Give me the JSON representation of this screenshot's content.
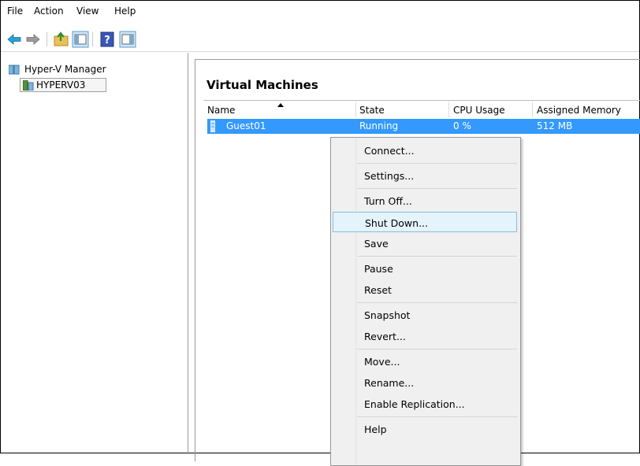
{
  "menubar": {
    "items": [
      "File",
      "Action",
      "View",
      "Help"
    ]
  },
  "toolbar": {
    "icons": [
      "back-arrow-icon",
      "forward-arrow-icon",
      "up-folder-icon",
      "show-hide-console-tree-icon",
      "help-icon",
      "show-hide-action-pane-icon"
    ]
  },
  "tree": {
    "root_label": "Hyper-V Manager",
    "server_label": "HYPERV03"
  },
  "pane": {
    "title": "Virtual Machines"
  },
  "table": {
    "headers": [
      "Name",
      "State",
      "CPU Usage",
      "Assigned Memory"
    ],
    "rows": [
      {
        "name": "Guest01",
        "state": "Running",
        "cpu": "0 %",
        "memory": "512 MB"
      }
    ]
  },
  "context_menu": {
    "items": [
      "Connect...",
      "Settings...",
      "Turn Off...",
      "Shut Down...",
      "Save",
      "Pause",
      "Reset",
      "Snapshot",
      "Revert...",
      "Move...",
      "Rename...",
      "Enable Replication...",
      "Help"
    ],
    "highlighted": "Shut Down..."
  },
  "colors": {
    "selection": "#3399ff",
    "menu_highlight": "#e5f3fb",
    "menu_bg": "#f0f0f0"
  }
}
